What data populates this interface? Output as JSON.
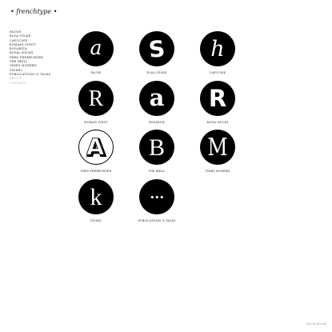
{
  "site": {
    "logo": "• frenchtype •"
  },
  "sidebar": {
    "items": [
      {
        "label": "Faune"
      },
      {
        "label": "Elsa Völkr"
      },
      {
        "label": "Capucine"
      },
      {
        "label": "Romain Vingt"
      },
      {
        "label": "Rogarità"
      },
      {
        "label": "Royal Rocks"
      },
      {
        "label": "Fred Freeburger"
      },
      {
        "label": "The Brill"
      },
      {
        "label": "Times Modern"
      },
      {
        "label": "Tindel"
      },
      {
        "label": "Publications & Talks"
      },
      {
        "label": "About"
      },
      {
        "label": "Contact"
      }
    ]
  },
  "typefaces": [
    {
      "glyph": "a",
      "caption": "Faune",
      "icon": "faune-a-icon"
    },
    {
      "glyph": "S",
      "caption": "Elsa Völkr",
      "icon": "elsa-volkr-s-icon"
    },
    {
      "glyph": "h",
      "caption": "Capucine",
      "icon": "capucine-h-icon"
    },
    {
      "glyph": "R",
      "caption": "Romain Vingt",
      "icon": "romain-vingt-r-icon"
    },
    {
      "glyph": "a",
      "caption": "Rogarità",
      "icon": "rogarita-a-icon"
    },
    {
      "glyph": "R",
      "caption": "Royal Rocks",
      "icon": "royal-rocks-r-icon"
    },
    {
      "glyph": "A",
      "caption": "Fred Freeburger",
      "icon": "fred-freeburger-a-icon"
    },
    {
      "glyph": "B",
      "caption": "The Brill",
      "icon": "the-brill-b-icon"
    },
    {
      "glyph": "M",
      "caption": "Times Modern",
      "icon": "times-modern-m-icon"
    },
    {
      "glyph": "k",
      "caption": "Tindel",
      "icon": "tindel-k-icon"
    },
    {
      "glyph": "•••",
      "caption": "Publications & Talks",
      "icon": "ellipsis-icon"
    }
  ],
  "footer": {
    "text": "Site by Bla bla"
  },
  "colors": {
    "disc": "#000000",
    "glyph": "#ffffff",
    "text": "#111111",
    "dim": "#a8a8a8"
  }
}
